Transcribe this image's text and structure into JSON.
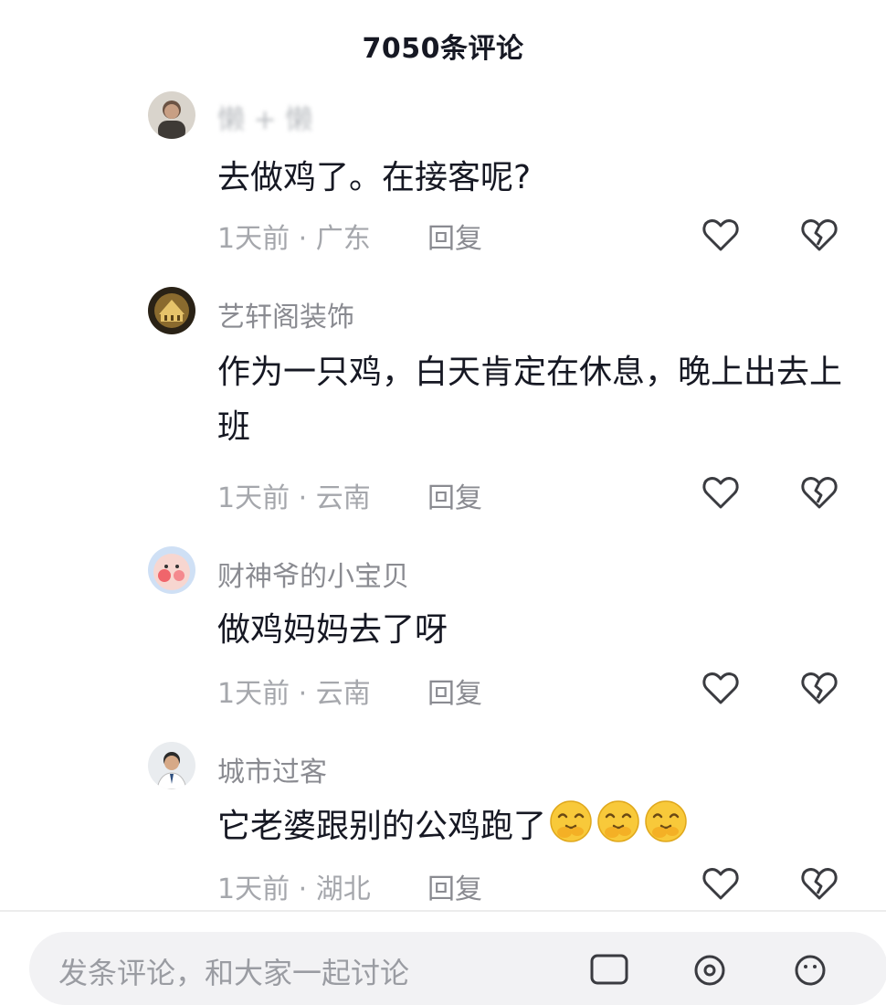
{
  "header": {
    "title": "7050条评论"
  },
  "comments": [
    {
      "username": "懒 + 懒",
      "text": "去做鸡了。在接客呢?",
      "meta": "1天前 · 广东",
      "reply_label": "回复",
      "emoji_count": 0
    },
    {
      "username": "艺轩阁装饰",
      "text": "作为一只鸡，白天肯定在休息，晚上出去上班",
      "meta": "1天前 · 云南",
      "reply_label": "回复",
      "emoji_count": 0
    },
    {
      "username": "财神爷的小宝贝",
      "text": "做鸡妈妈去了呀",
      "meta": "1天前 · 云南",
      "reply_label": "回复",
      "emoji_count": 0
    },
    {
      "username": "城市过客",
      "text": "它老婆跟别的公鸡跑了",
      "meta": "1天前 · 湖北",
      "reply_label": "回复",
      "emoji_count": 3,
      "emoji_name": "giggle-emoji"
    }
  ],
  "input": {
    "placeholder": "发条评论，和大家一起讨论"
  },
  "icons": {
    "like": "heart-outline-icon",
    "dislike": "broken-heart-icon",
    "input_icons": [
      "image-icon",
      "at-icon",
      "emoji-icon"
    ]
  },
  "colors": {
    "text_primary": "#161823",
    "text_secondary": "#8a8b91",
    "text_meta": "#a5a7ac",
    "input_bg": "#f2f2f4"
  }
}
